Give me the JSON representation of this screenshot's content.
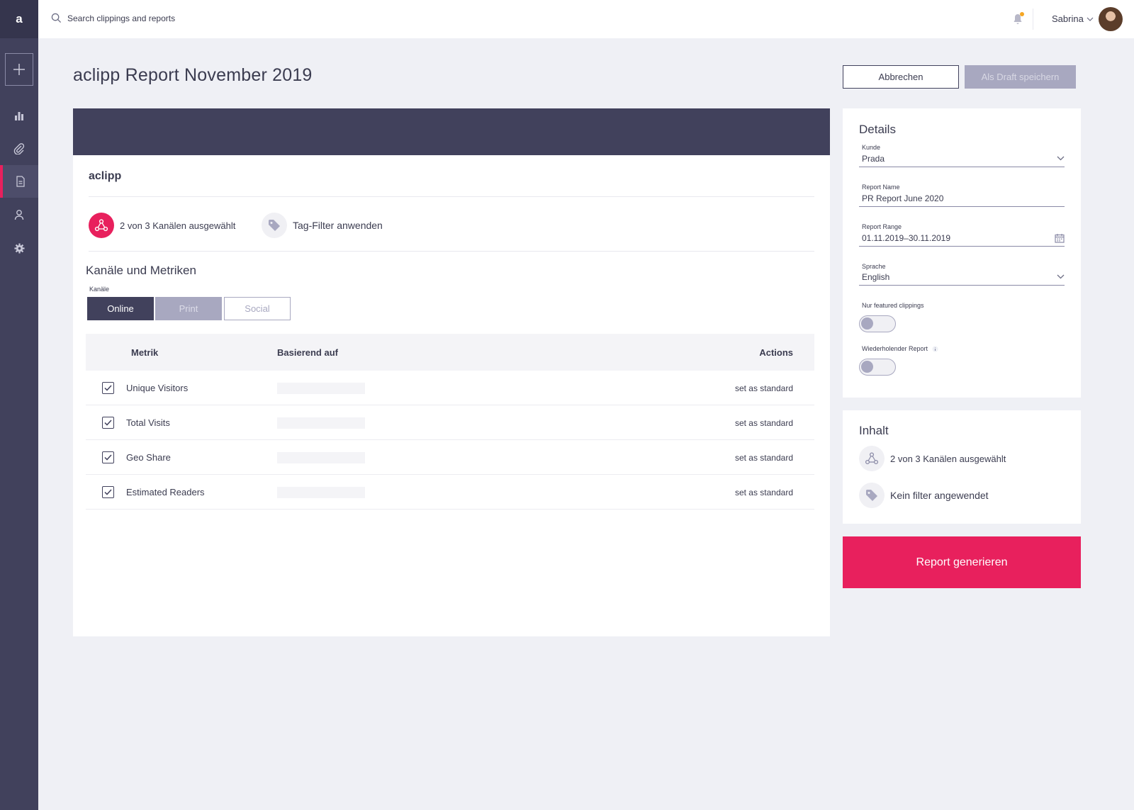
{
  "app": {
    "logo": "a"
  },
  "sidebar": {
    "items": [
      {
        "name": "add",
        "icon": "plus-icon"
      },
      {
        "name": "analytics",
        "icon": "bar-chart-icon"
      },
      {
        "name": "clippings",
        "icon": "paperclip-icon"
      },
      {
        "name": "reports",
        "icon": "document-icon",
        "active": true
      },
      {
        "name": "users",
        "icon": "user-icon"
      },
      {
        "name": "settings",
        "icon": "gear-icon"
      }
    ]
  },
  "topbar": {
    "search_placeholder": "Search clippings and reports",
    "user_name": "Sabrina",
    "notification_color": "#f5a623"
  },
  "header": {
    "title": "aclipp Report November 2019",
    "cancel_label": "Abbrechen",
    "draft_label": "Als Draft speichern"
  },
  "main": {
    "client": "aclipp",
    "channels_selected": "2 von 3 Kanälen ausgewählt",
    "tag_filter": "Tag-Filter anwenden",
    "section_title": "Kanäle und Metriken",
    "channels_label": "Kanäle",
    "channels": [
      {
        "label": "Online",
        "state": "active"
      },
      {
        "label": "Print",
        "state": "selected"
      },
      {
        "label": "Social",
        "state": "inactive"
      }
    ],
    "table": {
      "headers": {
        "metric": "Metrik",
        "based_on": "Basierend auf",
        "actions": "Actions"
      },
      "rows": [
        {
          "label": "Unique Visitors",
          "checked": true,
          "action": "set as standard"
        },
        {
          "label": "Total Visits",
          "checked": true,
          "action": "set as standard"
        },
        {
          "label": "Geo Share",
          "checked": true,
          "action": "set as standard"
        },
        {
          "label": "Estimated Readers",
          "checked": true,
          "action": "set as standard"
        }
      ]
    }
  },
  "details": {
    "title": "Details",
    "kunde_label": "Kunde",
    "kunde_value": "Prada",
    "report_name_label": "Report Name",
    "report_name_value": "PR Report June 2020",
    "report_range_label": "Report Range",
    "report_range_value": "01.11.2019–30.11.2019",
    "sprache_label": "Sprache",
    "sprache_value": "English",
    "featured_label": "Nur featured clippings",
    "featured_on": false,
    "recurring_label": "Wiederholender Report",
    "recurring_on": false
  },
  "inhalt": {
    "title": "Inhalt",
    "channels_text": "2 von 3 Kanälen ausgewählt",
    "filter_text": "Kein filter angewendet"
  },
  "generate_label": "Report generieren",
  "colors": {
    "accent": "#e8205d",
    "sidebar": "#41415c",
    "background": "#eff0f5"
  }
}
